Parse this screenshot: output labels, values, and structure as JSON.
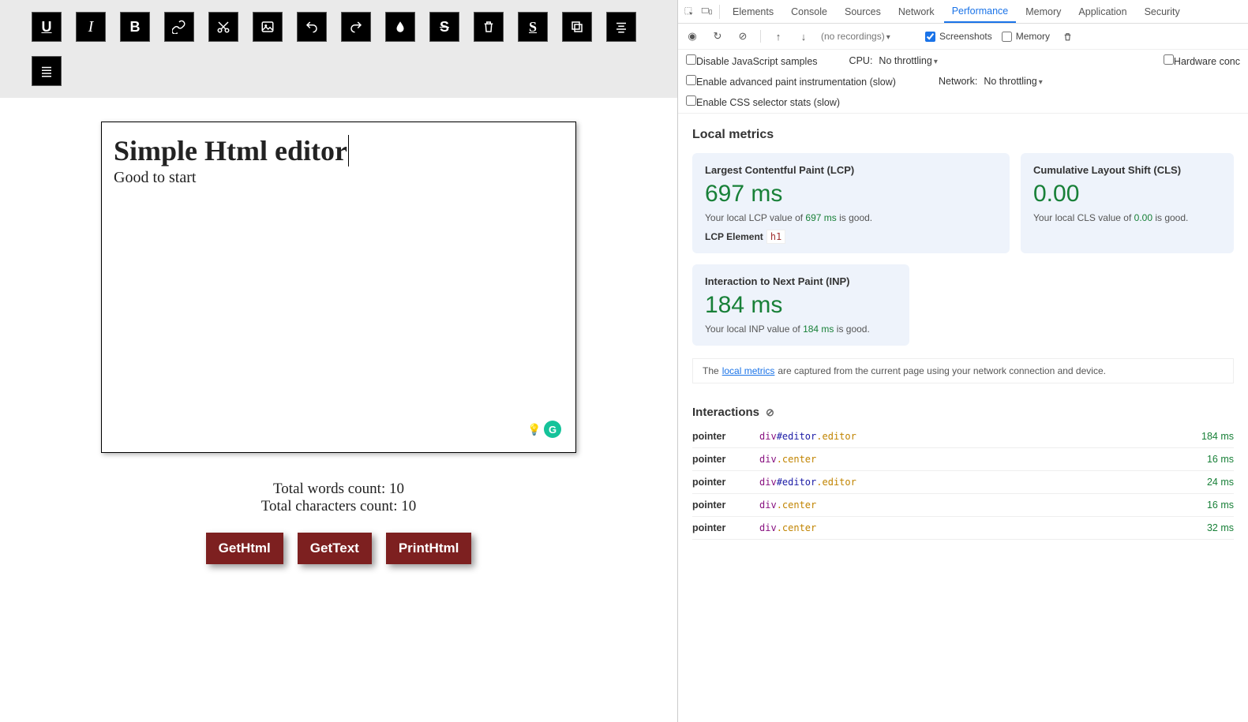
{
  "toolbar": {
    "buttons": [
      "underline",
      "italic",
      "bold",
      "link",
      "cut",
      "image",
      "undo",
      "redo",
      "drop",
      "strike",
      "delete",
      "style",
      "copy",
      "align-center",
      "align-justify"
    ]
  },
  "editor": {
    "heading": "Simple Html editor",
    "body": "Good to start"
  },
  "counts": {
    "words_label": "Total words count: ",
    "words_value": "10",
    "chars_label": "Total characters count: ",
    "chars_value": "10"
  },
  "actions": {
    "getHtml": "GetHtml",
    "getText": "GetText",
    "printHtml": "PrintHtml"
  },
  "devtools": {
    "tabs": [
      "Elements",
      "Console",
      "Sources",
      "Network",
      "Performance",
      "Memory",
      "Application",
      "Security"
    ],
    "activeTab": "Performance",
    "recordRow": {
      "noRecordings": "(no recordings)",
      "screenshots": "Screenshots",
      "memory": "Memory"
    },
    "settings": {
      "disableJs": "Disable JavaScript samples",
      "enablePaint": "Enable advanced paint instrumentation (slow)",
      "enableCss": "Enable CSS selector stats (slow)",
      "cpuLabel": "CPU:",
      "cpuValue": "No throttling",
      "netLabel": "Network:",
      "netValue": "No throttling",
      "hwConc": "Hardware conc"
    },
    "metrics": {
      "heading": "Local metrics",
      "lcp": {
        "title": "Largest Contentful Paint (LCP)",
        "value": "697 ms",
        "descPre": "Your local LCP value of ",
        "descVal": "697 ms",
        "descPost": " is good.",
        "elementLabel": "LCP Element",
        "elementTag": "h1"
      },
      "cls": {
        "title": "Cumulative Layout Shift (CLS)",
        "value": "0.00",
        "descPre": "Your local CLS value of ",
        "descVal": "0.00",
        "descPost": " is good."
      },
      "inp": {
        "title": "Interaction to Next Paint (INP)",
        "value": "184 ms",
        "descPre": "Your local INP value of ",
        "descVal": "184 ms",
        "descPost": " is good."
      },
      "notePre": "The ",
      "noteLink": "local metrics",
      "notePost": " are captured from the current page using your network connection and device."
    },
    "interactions": {
      "heading": "Interactions",
      "rows": [
        {
          "type": "pointer",
          "el": "div",
          "id": "#editor",
          "cls": ".editor",
          "time": "184 ms"
        },
        {
          "type": "pointer",
          "el": "div",
          "id": "",
          "cls": ".center",
          "time": "16 ms"
        },
        {
          "type": "pointer",
          "el": "div",
          "id": "#editor",
          "cls": ".editor",
          "time": "24 ms"
        },
        {
          "type": "pointer",
          "el": "div",
          "id": "",
          "cls": ".center",
          "time": "16 ms"
        },
        {
          "type": "pointer",
          "el": "div",
          "id": "",
          "cls": ".center",
          "time": "32 ms"
        }
      ]
    }
  }
}
